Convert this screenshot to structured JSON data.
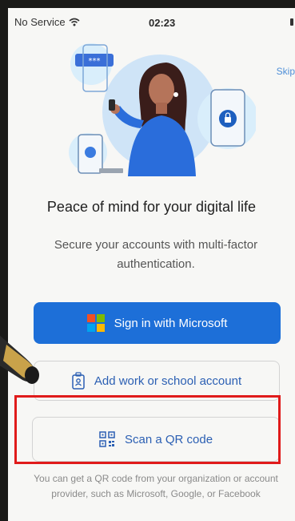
{
  "status_bar": {
    "carrier": "No Service",
    "time": "02:23"
  },
  "skip_label": "Skip",
  "headline": "Peace of mind for your digital life",
  "subtext": "Secure your accounts with multi-factor authentication.",
  "buttons": {
    "sign_in": "Sign in with Microsoft",
    "add_account": "Add work or school account",
    "scan_qr": "Scan a QR code"
  },
  "footnote": "You can get a QR code from your organization or account provider, such as Microsoft, Google, or Facebook",
  "colors": {
    "primary_blue": "#1d6fd8",
    "link_blue": "#2b5fb3",
    "highlight_red": "#e01b1b",
    "ms_red": "#f25022",
    "ms_green": "#7fba00",
    "ms_blue": "#00a4ef",
    "ms_yellow": "#ffb900"
  }
}
